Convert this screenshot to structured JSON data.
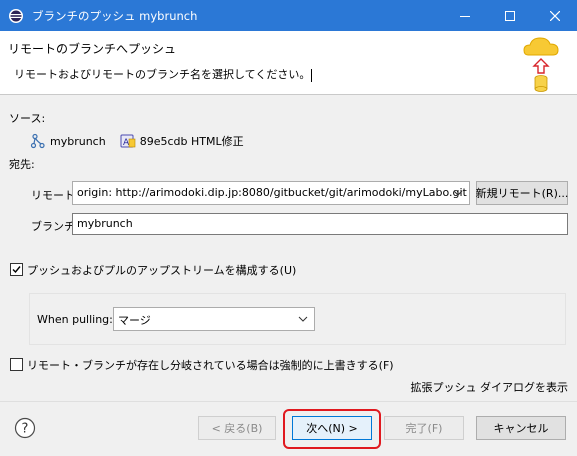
{
  "window": {
    "title": "ブランチのプッシュ mybrunch",
    "icon": "eclipse-icon",
    "controls": [
      "minimize-icon",
      "maximize-icon",
      "close-icon"
    ],
    "title_bar_color": "#2b78d6"
  },
  "banner": {
    "heading": "リモートのブランチへプッシュ",
    "message": "リモートおよびリモートのブランチ名を選択してください。"
  },
  "source": {
    "label": "ソース:",
    "branch": "mybrunch",
    "commit_id": "89e5cdb",
    "commit_message": "HTML修正"
  },
  "destination": {
    "label": "宛先:",
    "remote_label": "リモート:",
    "remote_value": "origin: http://arimodoki.dip.jp:8080/gitbucket/git/arimodoki/myLabo.git",
    "new_remote_button": "新規リモート(R)...",
    "branch_label": "ブランチ:",
    "branch_value": "mybrunch"
  },
  "upstream": {
    "checked": true,
    "label": "プッシュおよびプルのアップストリームを構成する(U)",
    "pull_label": "When pulling:",
    "pull_value": "マージ"
  },
  "force": {
    "checked": false,
    "label": "リモート・ブランチが存在し分岐されている場合は強制的に上書きする(F)"
  },
  "advanced_link": "拡張プッシュ ダイアログを表示",
  "footer": {
    "back": "< 戻る(B)",
    "next": "次へ(N) >",
    "finish": "完了(F)",
    "cancel": "キャンセル"
  },
  "colors": {
    "accent": "#0078d7",
    "highlight": "#e0191f"
  }
}
